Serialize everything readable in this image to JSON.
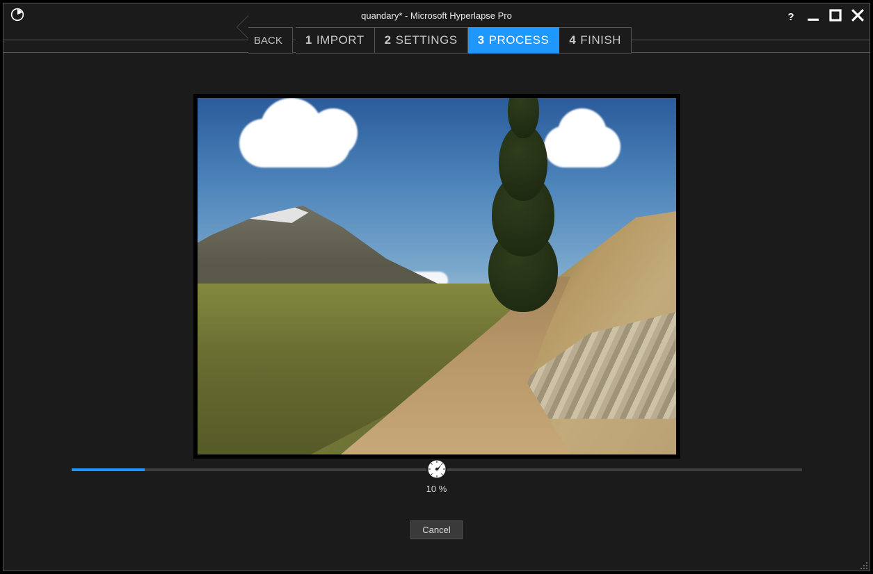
{
  "window": {
    "title": "quandary* - Microsoft Hyperlapse Pro"
  },
  "nav": {
    "back": "BACK",
    "steps": [
      {
        "num": "1",
        "label": "IMPORT",
        "active": false
      },
      {
        "num": "2",
        "label": "SETTINGS",
        "active": false
      },
      {
        "num": "3",
        "label": "PROCESS",
        "active": true
      },
      {
        "num": "4",
        "label": "FINISH",
        "active": false
      }
    ]
  },
  "progress": {
    "percent": 10,
    "label": "10 %"
  },
  "actions": {
    "cancel": "Cancel"
  },
  "colors": {
    "accent": "#1e98ff"
  }
}
